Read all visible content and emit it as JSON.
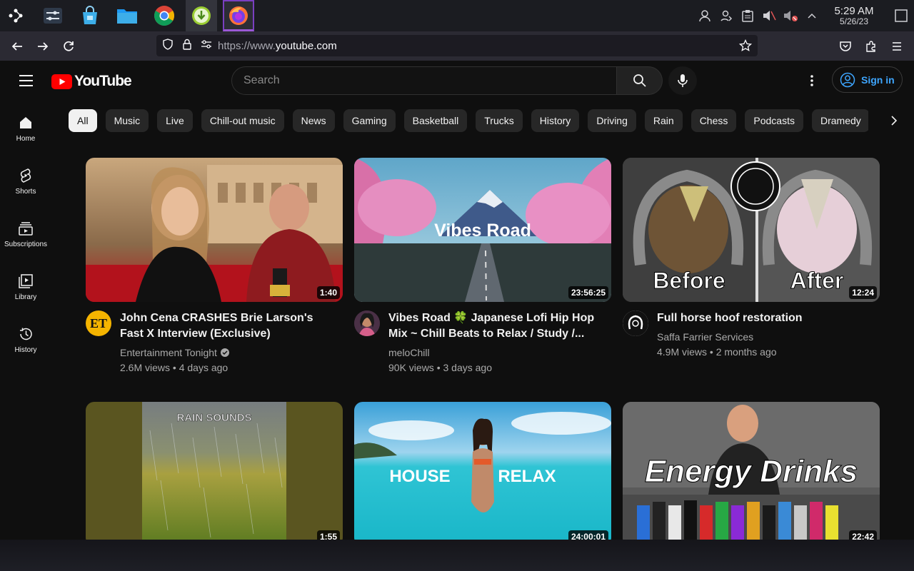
{
  "taskbar": {
    "apps": [
      "application-launcher",
      "system-settings",
      "discover-store",
      "file-manager",
      "chrome",
      "download-manager",
      "firefox"
    ],
    "clock": {
      "time": "5:29 AM",
      "date": "5/26/23"
    }
  },
  "browser": {
    "url_prefix": "https://www.",
    "url_domain": "youtube.com"
  },
  "youtube": {
    "logo_text": "YouTube",
    "search_placeholder": "Search",
    "sign_in": "Sign in",
    "guide": [
      {
        "label": "Home",
        "icon": "home-icon"
      },
      {
        "label": "Shorts",
        "icon": "shorts-icon"
      },
      {
        "label": "Subscriptions",
        "icon": "subscriptions-icon"
      },
      {
        "label": "Library",
        "icon": "library-icon"
      },
      {
        "label": "History",
        "icon": "history-icon"
      }
    ],
    "chips": [
      "All",
      "Music",
      "Live",
      "Chill-out music",
      "News",
      "Gaming",
      "Basketball",
      "Trucks",
      "History",
      "Driving",
      "Rain",
      "Chess",
      "Podcasts",
      "Dramedy"
    ],
    "selected_chip": "All",
    "videos": [
      {
        "title": "John Cena CRASHES Brie Larson's Fast X Interview (Exclusive)",
        "channel": "Entertainment Tonight",
        "verified": true,
        "stats": "2.6M views • 4 days ago",
        "duration": "1:40",
        "avatar_text": "ET"
      },
      {
        "title": "Vibes Road 🍀 Japanese Lofi Hip Hop Mix ~ Chill Beats to Relax / Study /...",
        "channel": "meloChill",
        "verified": false,
        "stats": "90K views • 3 days ago",
        "duration": "23:56:25",
        "thumb_text": "Vibes Road"
      },
      {
        "title": "Full horse hoof restoration",
        "channel": "Saffa Farrier Services",
        "verified": false,
        "stats": "4.9M views • 2 months ago",
        "duration": "12:24",
        "thumb_left": "Before",
        "thumb_right": "After"
      },
      {
        "duration": "1:55",
        "thumb_text": "RAIN SOUNDS"
      },
      {
        "duration": "24:00:01",
        "thumb_left": "HOUSE",
        "thumb_right": "RELAX"
      },
      {
        "duration": "22:42",
        "thumb_text": "Energy Drinks"
      }
    ]
  },
  "colors": {
    "accent_blue": "#3ea6ff",
    "youtube_red": "#ff0000",
    "background": "#0f0f0f"
  }
}
